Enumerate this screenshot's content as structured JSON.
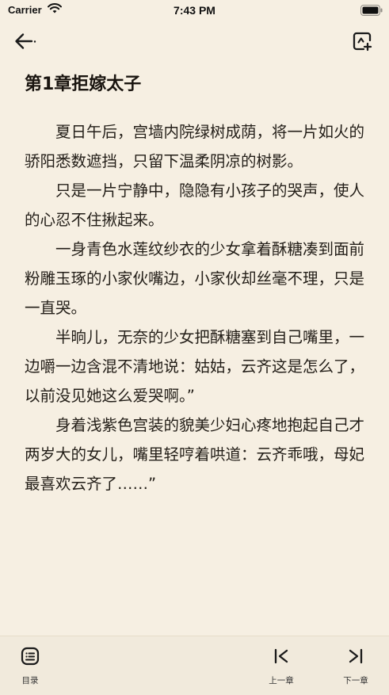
{
  "status_bar": {
    "carrier": "Carrier",
    "time": "7:43 PM"
  },
  "nav": {
    "back_icon": "back-arrow-icon",
    "bookmark_icon": "add-bookmark-icon"
  },
  "chapter": {
    "title": "第1章拒嫁太子",
    "paragraphs": [
      "夏日午后，宫墙内院绿树成荫，将一片如火的骄阳悉数遮挡，只留下温柔阴凉的树影。",
      "只是一片宁静中，隐隐有小孩子的哭声，使人的心忍不住揪起来。",
      "一身青色水莲纹纱衣的少女拿着酥糖凑到面前粉雕玉琢的小家伙嘴边，小家伙却丝毫不理，只是一直哭。",
      "半晌儿，无奈的少女把酥糖塞到自己嘴里，一边嚼一边含混不清地说：姑姑，云齐这是怎么了，以前没见她这么爱哭啊。”",
      "身着浅紫色宫装的貌美少妇心疼地抱起自己才两岁大的女儿，嘴里轻哼着哄道：云齐乖哦，母妃最喜欢云齐了……”"
    ]
  },
  "toolbar": {
    "catalog_label": "目录",
    "prev_label": "上一章",
    "next_label": "下一章"
  }
}
